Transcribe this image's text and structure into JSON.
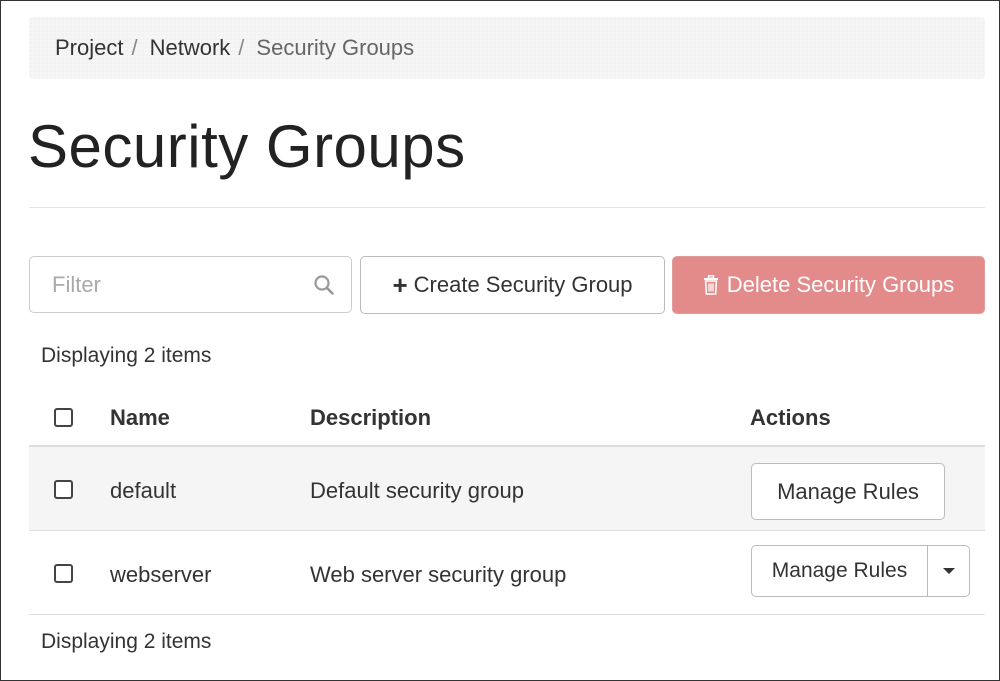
{
  "breadcrumb": {
    "items": [
      "Project",
      "Network",
      "Security Groups"
    ],
    "separator": "/"
  },
  "page": {
    "title": "Security Groups"
  },
  "toolbar": {
    "filter_placeholder": "Filter",
    "filter_icon": "search-icon",
    "create_label": "Create Security Group",
    "create_icon": "plus-icon",
    "delete_label": "Delete Security Groups",
    "delete_icon": "trash-icon",
    "delete_color": "#e38a8a"
  },
  "table": {
    "count_top": "Displaying 2 items",
    "count_bottom": "Displaying 2 items",
    "headers": {
      "name": "Name",
      "description": "Description",
      "actions": "Actions"
    },
    "rows": [
      {
        "name": "default",
        "description": "Default security group",
        "action_label": "Manage Rules",
        "has_dropdown": false
      },
      {
        "name": "webserver",
        "description": "Web server security group",
        "action_label": "Manage Rules",
        "has_dropdown": true
      }
    ]
  }
}
